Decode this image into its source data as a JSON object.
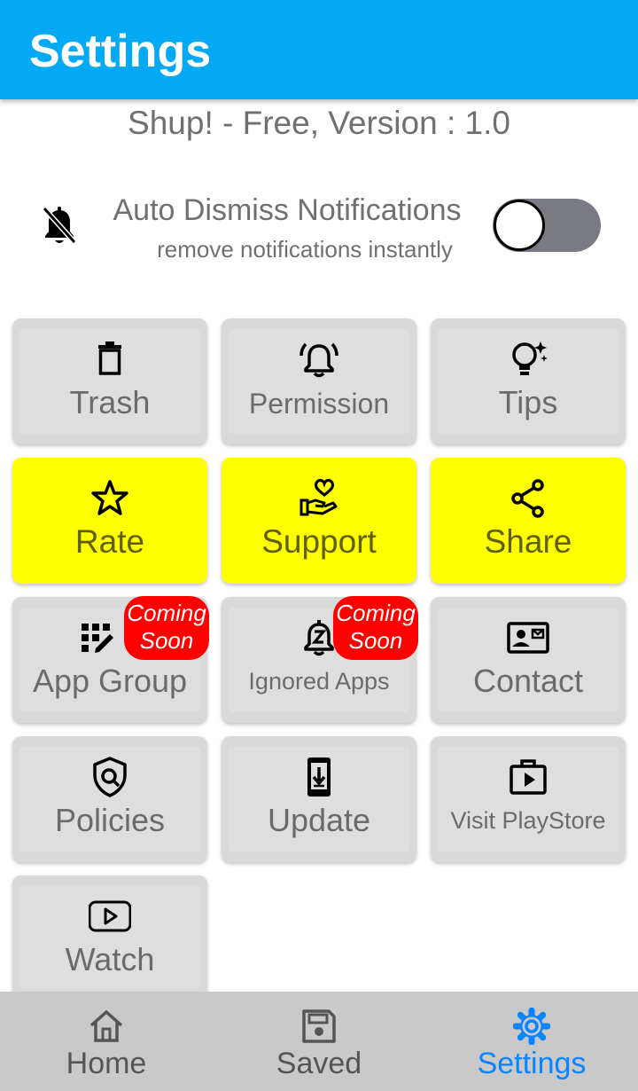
{
  "appbar": {
    "title": "Settings"
  },
  "version_text": "Shup! - Free, Version : 1.0",
  "auto_dismiss": {
    "title": "Auto Dismiss Notifications",
    "subtitle": "remove notifications instantly",
    "enabled": false,
    "icon": "notifications-off-icon"
  },
  "tiles": [
    {
      "label": "Trash",
      "icon": "trash-icon"
    },
    {
      "label": "Permission",
      "icon": "alarm-bell-icon"
    },
    {
      "label": "Tips",
      "icon": "lightbulb-icon"
    },
    {
      "label": "Rate",
      "icon": "star-icon"
    },
    {
      "label": "Support",
      "icon": "heart-hand-icon"
    },
    {
      "label": "Share",
      "icon": "share-icon"
    },
    {
      "label": "App Group",
      "icon": "app-group-icon",
      "badge": [
        "Coming",
        "Soon"
      ]
    },
    {
      "label": "Ignored Apps",
      "icon": "snooze-bell-icon",
      "badge": [
        "Coming",
        "Soon"
      ]
    },
    {
      "label": "Contact",
      "icon": "contact-card-icon"
    },
    {
      "label": "Policies",
      "icon": "shield-icon"
    },
    {
      "label": "Update",
      "icon": "phone-download-icon"
    },
    {
      "label": "Visit PlayStore",
      "icon": "play-store-icon"
    },
    {
      "label": "Watch",
      "icon": "video-play-icon"
    }
  ],
  "bottom_nav": [
    {
      "label": "Home",
      "icon": "home-icon",
      "active": false
    },
    {
      "label": "Saved",
      "icon": "save-icon",
      "active": false
    },
    {
      "label": "Settings",
      "icon": "gear-icon",
      "active": true
    }
  ],
  "colors": {
    "appbar": "#03A9F4",
    "accent_tile": "#FFFF00",
    "badge": "#FF0000",
    "nav_active": "#0A84FF",
    "toggle_track_off": "#7A7A82"
  }
}
